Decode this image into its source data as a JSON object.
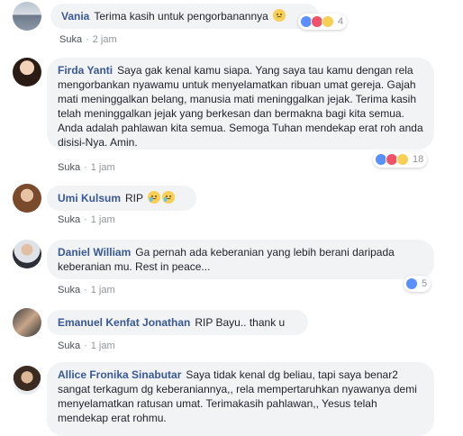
{
  "colors": {
    "author": "#385898",
    "bubble": "#f2f3f5",
    "meta": "#90949c"
  },
  "comments": [
    {
      "author": "Vania",
      "text": "Terima kasih untuk pengorbanannya",
      "like_label": "Suka",
      "time": "2 jam",
      "reactions": "4"
    },
    {
      "author": "Firda Yanti",
      "text": "Saya gak kenal kamu siapa. Yang saya tau kamu dengan rela mengorbankan nyawamu untuk menyelamatkan ribuan umat gereja. Gajah mati meninggalkan belang, manusia mati meninggalkan jejak. Terima kasih telah meninggalkan jejak yang berkesan dan bermakna bagi kita semua. Anda adalah pahlawan kita semua. Semoga Tuhan mendekap erat roh anda disisi-Nya. Amin.",
      "like_label": "Suka",
      "time": "1 jam",
      "reactions": "18"
    },
    {
      "author": "Umi Kulsum",
      "text": "RIP",
      "like_label": "Suka",
      "time": "1 jam"
    },
    {
      "author": "Daniel William",
      "text": "Ga pernah ada keberanian yang lebih berani daripada keberanian mu. Rest in peace...",
      "like_label": "Suka",
      "time": "1 jam",
      "reactions": "5"
    },
    {
      "author": "Emanuel Kenfat Jonathan",
      "text": "RIP Bayu.. thank u",
      "like_label": "Suka",
      "time": "1 jam"
    },
    {
      "author": "Allice Fronika Sinabutar",
      "text": "Saya tidak kenal dg beliau, tapi saya benar2 sangat terkagum dg keberaniannya,, rela mempertaruhkan nyawanya demi menyelamatkan ratusan umat. Terimakasih pahlawan,, Yesus telah mendekap erat rohmu."
    }
  ]
}
